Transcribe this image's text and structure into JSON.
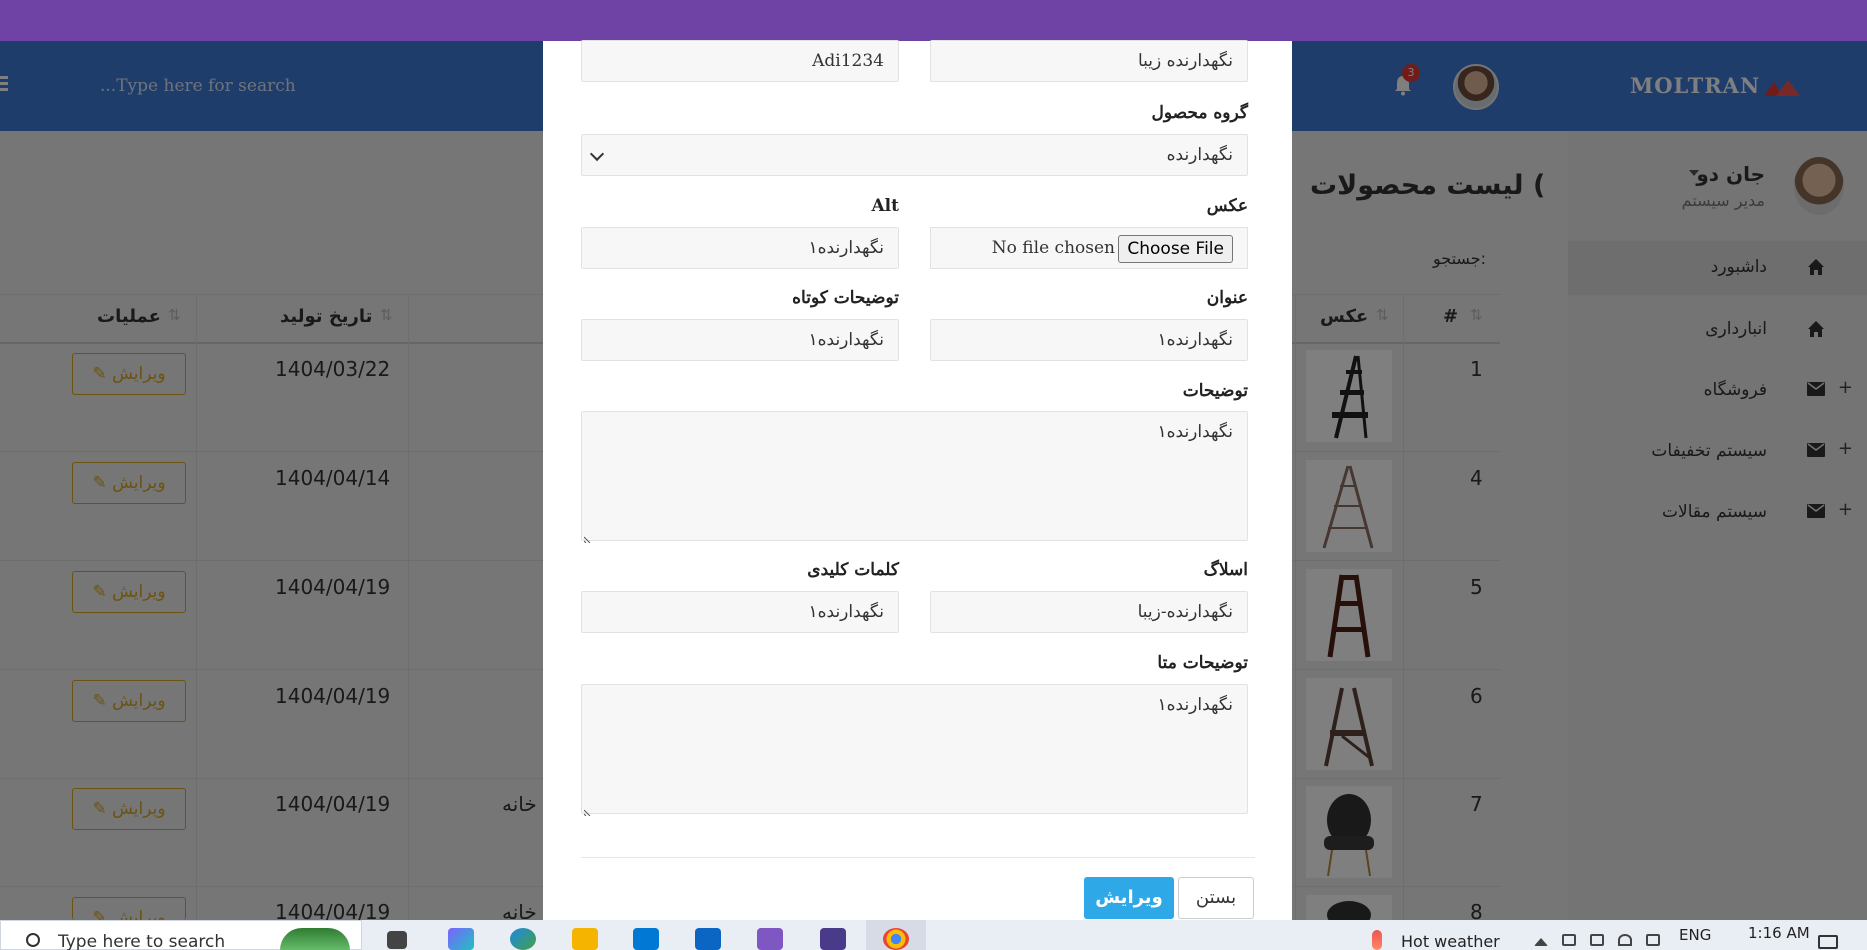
{
  "header": {
    "search_placeholder": "...Type here for search",
    "logo": "MOLTRAN",
    "notification_count": "3"
  },
  "sidebar": {
    "user_name": "جان دو",
    "user_role": "مدیر سیستم",
    "items": [
      {
        "label": "داشبورد",
        "icon": "home-icon",
        "expandable": false
      },
      {
        "label": "انبارداری",
        "icon": "home-icon",
        "expandable": false
      },
      {
        "label": "فروشگاه",
        "icon": "envelope-icon",
        "expandable": true
      },
      {
        "label": "سیستم تخفیفات",
        "icon": "envelope-icon",
        "expandable": true
      },
      {
        "label": "سیستم مقالات",
        "icon": "envelope-icon",
        "expandable": true
      }
    ],
    "plus": "+"
  },
  "main": {
    "title": "لیست محصولات (",
    "search_label": "جستجو:",
    "columns": {
      "id": "#",
      "image": "عکس",
      "date": "تاریخ تولید",
      "actions": "عملیات"
    },
    "rows": [
      {
        "id": "1",
        "date": "1404/03/22",
        "extra": "",
        "edit": "ویرایش"
      },
      {
        "id": "4",
        "date": "1404/04/14",
        "extra": "",
        "edit": "ویرایش"
      },
      {
        "id": "5",
        "date": "1404/04/19",
        "extra": "",
        "edit": "ویرایش"
      },
      {
        "id": "6",
        "date": "1404/04/19",
        "extra": "",
        "edit": "ویرایش"
      },
      {
        "id": "7",
        "date": "1404/04/19",
        "extra": "خانه",
        "edit": "ویرایش"
      },
      {
        "id": "8",
        "date": "1404/04/19",
        "extra": "خانه",
        "edit": "ویرایش"
      }
    ]
  },
  "modal": {
    "top_left_value": "Adi1234",
    "top_right_value": "نگهدارنده زیبا",
    "group_label": "گروه محصول",
    "group_value": "نگهدارنده",
    "image_label": "عکس",
    "file_button": "Choose File",
    "file_status": "No file chosen",
    "alt_label": "Alt",
    "alt_value": "نگهدارنده۱",
    "title_label": "عنوان",
    "title_value": "نگهدارنده۱",
    "short_desc_label": "توضیحات کوتاه",
    "short_desc_value": "نگهدارنده۱",
    "desc_label": "توضیحات",
    "desc_value": "نگهدارنده۱",
    "slug_label": "اسلاگ",
    "slug_value": "نگهدارنده-زیبا",
    "keywords_label": "کلمات کلیدی",
    "keywords_value": "نگهدارنده۱",
    "meta_label": "توضیحات متا",
    "meta_value": "نگهدارنده۱",
    "close_button": "بستن",
    "submit_button": "ویرایش"
  },
  "taskbar": {
    "search_text": "Type here to search",
    "weather": "Hot weather",
    "lang": "ENG",
    "time": "1:16 AM"
  }
}
